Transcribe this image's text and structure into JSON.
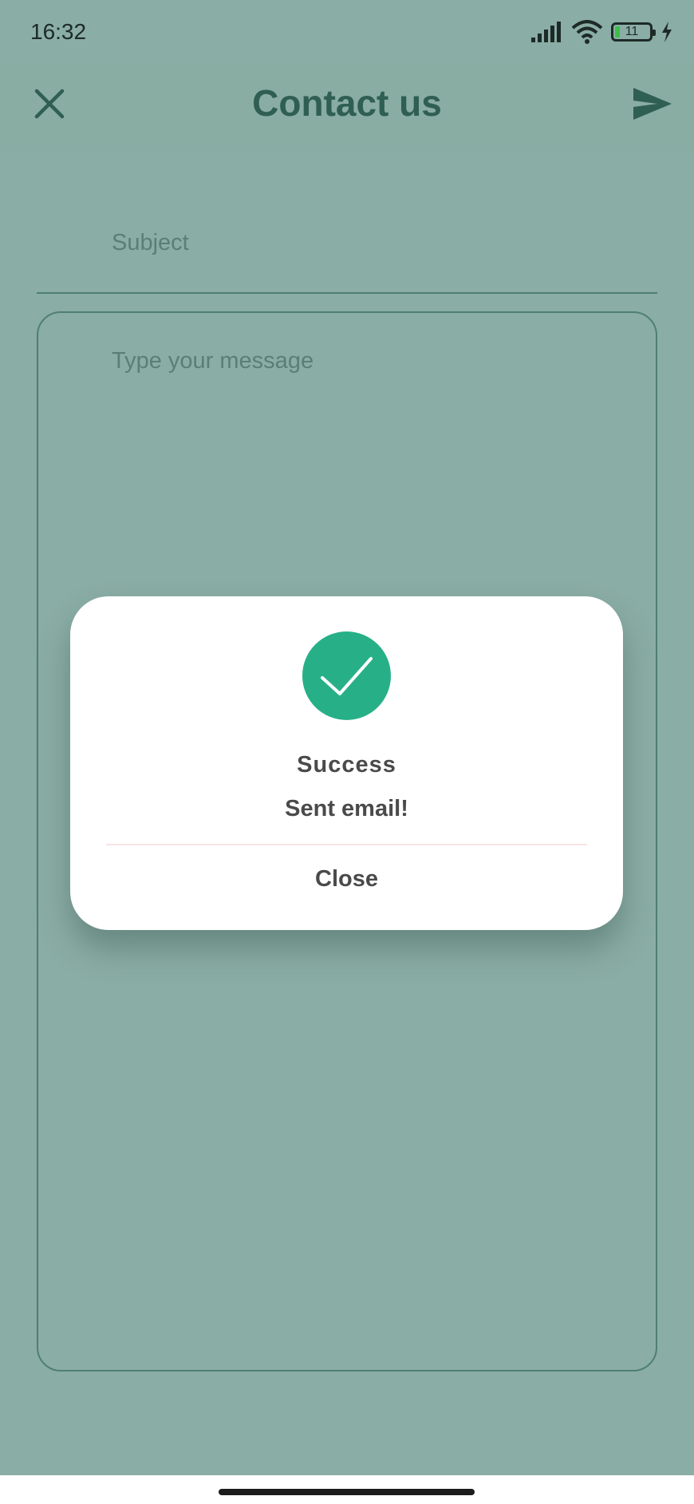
{
  "status_bar": {
    "time": "16:32",
    "battery_level": "11",
    "icons": [
      "signal-icon",
      "wifi-icon",
      "battery-icon",
      "charging-icon"
    ]
  },
  "app_bar": {
    "title": "Contact us",
    "close_icon": "close-icon",
    "send_icon": "send-icon"
  },
  "form": {
    "subject_placeholder": "Subject",
    "message_placeholder": "Type your message"
  },
  "dialog": {
    "icon": "check-icon",
    "title": "Success",
    "message": "Sent email!",
    "close_label": "Close"
  },
  "colors": {
    "background": "#8aada5",
    "accent": "#2f5f52",
    "success": "#27b088"
  }
}
